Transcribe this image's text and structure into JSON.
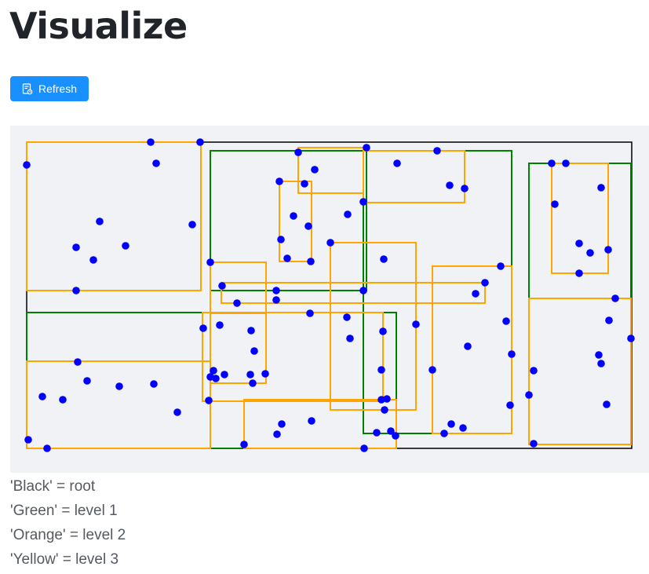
{
  "page": {
    "title": "Visualize"
  },
  "toolbar": {
    "refresh_label": "Refresh",
    "refresh_icon": "document-refresh-icon",
    "button_color": "#1890ff"
  },
  "canvas": {
    "background": "#f0f2f5",
    "colors": {
      "root": "#000000",
      "level1": "#008000",
      "level2": "#ffa500",
      "point": "#0000ff"
    },
    "root_rects": [
      [
        34,
        181,
        805,
        571
      ]
    ],
    "level1_rects": [
      [
        268,
        192,
        467,
        370
      ],
      [
        463,
        192,
        652,
        552
      ],
      [
        674,
        208,
        804,
        380
      ],
      [
        34,
        398,
        505,
        571
      ],
      [
        268,
        398,
        505,
        571
      ]
    ],
    "level2_rects": [
      [
        34,
        181,
        256,
        370
      ],
      [
        380,
        188,
        463,
        246
      ],
      [
        463,
        192,
        592,
        258
      ],
      [
        356,
        231,
        397,
        333
      ],
      [
        703,
        208,
        775,
        348
      ],
      [
        268,
        334,
        339,
        398
      ],
      [
        282,
        360,
        618,
        386
      ],
      [
        421,
        309,
        530,
        522
      ],
      [
        551,
        339,
        652,
        552
      ],
      [
        674,
        380,
        804,
        566
      ],
      [
        258,
        398,
        488,
        511
      ],
      [
        34,
        460,
        268,
        571
      ],
      [
        268,
        399,
        339,
        488
      ],
      [
        311,
        509,
        505,
        571
      ]
    ],
    "points": [
      [
        34,
        210
      ],
      [
        192,
        181
      ],
      [
        255,
        181
      ],
      [
        199,
        208
      ],
      [
        127,
        282
      ],
      [
        97,
        315
      ],
      [
        119,
        331
      ],
      [
        160,
        313
      ],
      [
        245,
        286
      ],
      [
        97,
        370
      ],
      [
        268,
        334
      ],
      [
        283,
        364
      ],
      [
        302,
        386
      ],
      [
        352,
        370
      ],
      [
        352,
        382
      ],
      [
        380,
        194
      ],
      [
        356,
        231
      ],
      [
        388,
        234
      ],
      [
        401,
        216
      ],
      [
        374,
        275
      ],
      [
        393,
        288
      ],
      [
        358,
        305
      ],
      [
        366,
        329
      ],
      [
        396,
        333
      ],
      [
        443,
        273
      ],
      [
        463,
        257
      ],
      [
        467,
        188
      ],
      [
        506,
        208
      ],
      [
        557,
        192
      ],
      [
        573,
        236
      ],
      [
        592,
        240
      ],
      [
        489,
        330
      ],
      [
        421,
        309
      ],
      [
        638,
        339
      ],
      [
        618,
        360
      ],
      [
        606,
        374
      ],
      [
        463,
        370
      ],
      [
        395,
        399
      ],
      [
        442,
        404
      ],
      [
        446,
        431
      ],
      [
        530,
        413
      ],
      [
        645,
        409
      ],
      [
        652,
        451
      ],
      [
        596,
        441
      ],
      [
        551,
        471
      ],
      [
        650,
        516
      ],
      [
        703,
        208
      ],
      [
        721,
        208
      ],
      [
        766,
        239
      ],
      [
        707,
        260
      ],
      [
        738,
        310
      ],
      [
        752,
        322
      ],
      [
        775,
        318
      ],
      [
        738,
        348
      ],
      [
        784,
        380
      ],
      [
        776,
        408
      ],
      [
        763,
        452
      ],
      [
        766,
        463
      ],
      [
        804,
        431
      ],
      [
        680,
        472
      ],
      [
        674,
        503
      ],
      [
        773,
        515
      ],
      [
        680,
        565
      ],
      [
        259,
        418
      ],
      [
        280,
        414
      ],
      [
        320,
        421
      ],
      [
        324,
        447
      ],
      [
        319,
        477
      ],
      [
        338,
        476
      ],
      [
        322,
        488
      ],
      [
        272,
        472
      ],
      [
        286,
        477
      ],
      [
        268,
        480
      ],
      [
        275,
        482
      ],
      [
        266,
        510
      ],
      [
        488,
        422
      ],
      [
        486,
        471
      ],
      [
        493,
        508
      ],
      [
        490,
        522
      ],
      [
        486,
        509
      ],
      [
        99,
        461
      ],
      [
        111,
        485
      ],
      [
        152,
        492
      ],
      [
        196,
        489
      ],
      [
        54,
        505
      ],
      [
        80,
        509
      ],
      [
        226,
        525
      ],
      [
        36,
        560
      ],
      [
        60,
        571
      ],
      [
        359,
        540
      ],
      [
        397,
        536
      ],
      [
        353,
        553
      ],
      [
        311,
        566
      ],
      [
        464,
        571
      ],
      [
        480,
        551
      ],
      [
        498,
        549
      ],
      [
        504,
        555
      ],
      [
        566,
        552
      ],
      [
        575,
        540
      ],
      [
        590,
        545
      ]
    ]
  },
  "legend": {
    "items": [
      "'Black' = root",
      "'Green' = level 1",
      "'Orange' = level 2",
      "'Yellow' = level 3"
    ]
  }
}
